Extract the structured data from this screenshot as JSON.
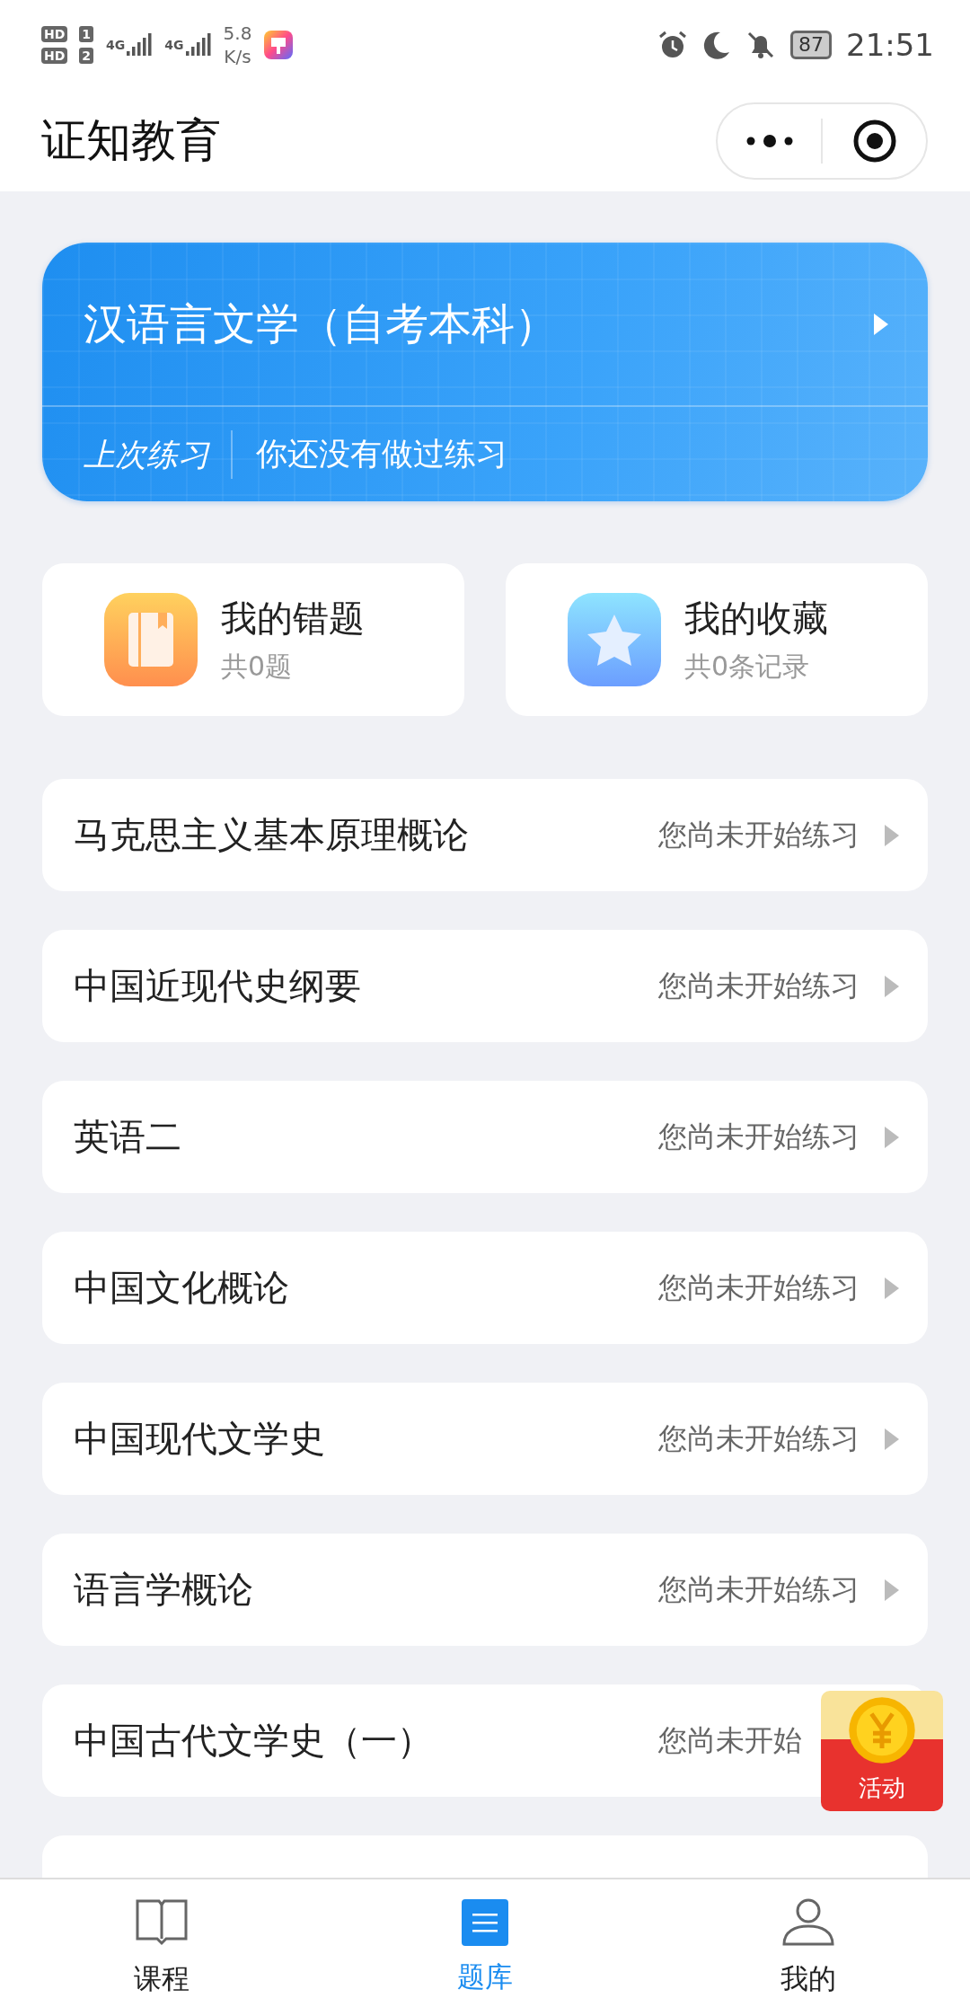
{
  "status_bar": {
    "sims": [
      {
        "hd": "HD",
        "slot": "1"
      },
      {
        "hd": "HD",
        "slot": "2"
      }
    ],
    "networks": [
      "4G",
      "4G"
    ],
    "speed": "5.8",
    "speed_unit": "K/s",
    "battery": "87",
    "time": "21:51"
  },
  "header": {
    "title": "证知教育"
  },
  "banner": {
    "title": "汉语言文学（自考本科）",
    "last_label": "上次练习",
    "last_value": "你还没有做过练习"
  },
  "shortcuts": [
    {
      "kind": "mistakes",
      "title": "我的错题",
      "subtitle": "共0题"
    },
    {
      "kind": "favorites",
      "title": "我的收藏",
      "subtitle": "共0条记录"
    }
  ],
  "subjects": [
    {
      "kind": "full",
      "name": "马克思主义基本原理概论",
      "status": "您尚未开始练习"
    },
    {
      "kind": "full",
      "name": "中国近现代史纲要",
      "status": "您尚未开始练习"
    },
    {
      "kind": "full",
      "name": "英语二",
      "status": "您尚未开始练习"
    },
    {
      "kind": "full",
      "name": "中国文化概论",
      "status": "您尚未开始练习"
    },
    {
      "kind": "full",
      "name": "中国现代文学史",
      "status": "您尚未开始练习"
    },
    {
      "kind": "full",
      "name": "语言学概论",
      "status": "您尚未开始练习"
    },
    {
      "kind": "covered",
      "name": "中国古代文学史（一）",
      "status": "您尚未开始"
    },
    {
      "kind": "clipped"
    }
  ],
  "promo": {
    "label": "活动"
  },
  "tabs": [
    {
      "kind": "book",
      "label": "课程",
      "selected": false
    },
    {
      "kind": "list",
      "label": "题库",
      "selected": true
    },
    {
      "kind": "person",
      "label": "我的",
      "selected": false
    }
  ]
}
